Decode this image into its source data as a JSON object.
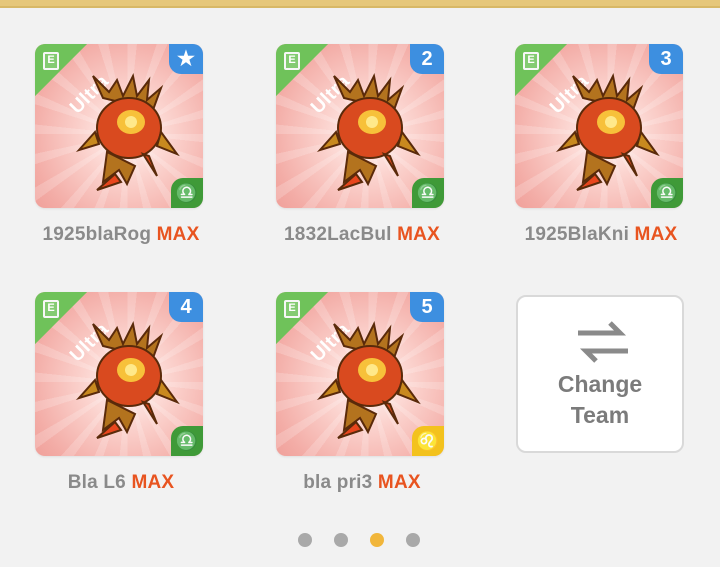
{
  "team": [
    {
      "name": "1925blaRog",
      "level": "MAX",
      "tier": "Ultra",
      "badge": "★",
      "badge_icon": "star-icon",
      "element": "libra",
      "element_symbol": "♎",
      "element_color": "#3f9a38"
    },
    {
      "name": "1832LacBul",
      "level": "MAX",
      "tier": "Ultra",
      "badge": "2",
      "element": "libra",
      "element_symbol": "♎",
      "element_color": "#3f9a38"
    },
    {
      "name": "1925BlaKni",
      "level": "MAX",
      "tier": "Ultra",
      "badge": "3",
      "element": "libra",
      "element_symbol": "♎",
      "element_color": "#3f9a38"
    },
    {
      "name": "Bla L6",
      "level": "MAX",
      "tier": "Ultra",
      "badge": "4",
      "element": "libra",
      "element_symbol": "♎",
      "element_color": "#3f9a38"
    },
    {
      "name": "bla pri3",
      "level": "MAX",
      "tier": "Ultra",
      "badge": "5",
      "element": "leo",
      "element_symbol": "♌",
      "element_color": "#f3c21d"
    }
  ],
  "change_team": {
    "line1": "Change",
    "line2": "Team",
    "icon": "swap-arrows-icon"
  },
  "pagination": {
    "total": 4,
    "active_index": 2
  },
  "colors": {
    "accent": "#e85420",
    "badge_blue": "#3d8fe0",
    "ribbon_green": "#6fc25a",
    "active_dot": "#f1b63b"
  }
}
